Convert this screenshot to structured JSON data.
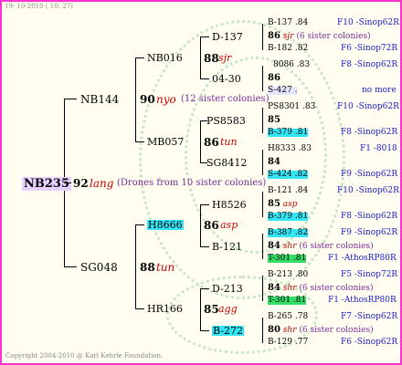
{
  "header": {
    "date": "19- 10-2010 ( 10: 27)"
  },
  "footer": {
    "copyright": "Copyright 2004-2010 @ Karl Kehrle Foundation."
  },
  "root": {
    "id": "NB235",
    "num": "92",
    "race": "lang",
    "note": "(Drones from 10 sister colonies)"
  },
  "sire": {
    "id": "NB144",
    "num": "90",
    "race": "nyo",
    "note": "(12 sister colonies)",
    "father": {
      "id": "NB016",
      "num": "88",
      "race": "sjr",
      "f": "D-137",
      "m": "04-30"
    },
    "mother": {
      "id": "MB057",
      "num": "86",
      "race": "tun",
      "f": "PS8583",
      "m": "SG8412"
    }
  },
  "dam": {
    "id": "SG048",
    "num": "88",
    "race": "tun",
    "father": {
      "id": "H8666",
      "num": "86",
      "race": "asp",
      "f": "H8526",
      "m": "B-121"
    },
    "mother": {
      "id": "HR166",
      "num": "85",
      "race": "agg",
      "f": "D-213",
      "m": "B-272"
    }
  },
  "gen4": [
    {
      "a": "B-137",
      "b": ".84",
      "r": "F10 -Sinop62R"
    },
    {
      "num": "86",
      "race": "sjr",
      "note": "(6 sister colonies)"
    },
    {
      "a": "B-182",
      "b": ".82",
      "r": "F6 -Sinop72R"
    },
    {
      "a": "8086",
      "b": ".83",
      "r": "F8 -Sinop62R"
    },
    {
      "num": "86"
    },
    {
      "a": "S-427",
      "b": ".",
      "r": "no more"
    },
    {
      "a": "PS8301",
      "b": ".83",
      "r": "F10 -Sinop62R"
    },
    {
      "num": "85"
    },
    {
      "a": "B-379",
      "b": ".81",
      "r": "F8 -Sinop62R"
    },
    {
      "a": "H8333",
      "b": ".83",
      "r": "F1 -8018"
    },
    {
      "num": "84"
    },
    {
      "a": "S-424",
      "b": ".82",
      "r": "F9 -Sinop62R"
    },
    {
      "a": "B-121",
      "b": ".84",
      "r": "F10 -Sinop62R"
    },
    {
      "num": "85",
      "race": "asp"
    },
    {
      "a": "B-379",
      "b": ".81",
      "r": "F8 -Sinop62R"
    },
    {
      "a": "B-387",
      "b": ".82",
      "r": "F9 -Sinop62R"
    },
    {
      "num": "84",
      "race": "shr",
      "note": "(6 sister colonies)"
    },
    {
      "a": "T-301",
      "b": ".81",
      "r": "F1 -AthosRP80R"
    },
    {
      "a": "B-213",
      "b": ".80",
      "r": "F5 -Sinop72R"
    },
    {
      "num": "84",
      "race": "shr",
      "note": "(6 sister colonies)"
    },
    {
      "a": "T-301",
      "b": ".81",
      "r": "F1 -AthosRP80R"
    },
    {
      "a": "B-265",
      "b": ".78",
      "r": "F7 -Sinop62R"
    },
    {
      "num": "80",
      "race": "shr",
      "note": "(6 sister colonies)"
    },
    {
      "a": "B-129",
      "b": ".77",
      "r": "F6 -Sinop62R"
    }
  ]
}
